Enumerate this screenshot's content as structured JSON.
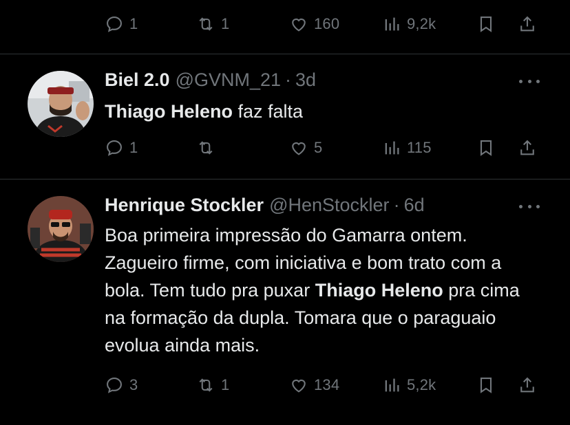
{
  "tweets": [
    {
      "stats": {
        "replies": "1",
        "retweets": "1",
        "likes": "160",
        "views": "9,2k"
      }
    },
    {
      "display_name": "Biel 2.0",
      "handle": "@GVNM_21",
      "separator": "·",
      "time": "3d",
      "text_bold_1": "Thiago Heleno",
      "text_1": " faz falta",
      "stats": {
        "replies": "1",
        "retweets": "",
        "likes": "5",
        "views": "115"
      }
    },
    {
      "display_name": "Henrique Stockler",
      "handle": "@HenStockler",
      "separator": "·",
      "time": "6d",
      "text_1": "Boa primeira impressão do Gamarra ontem. Zagueiro firme, com iniciativa e bom trato com a bola. Tem tudo pra puxar ",
      "text_bold_1": "Thiago Heleno",
      "text_2": " pra cima na formação da dupla. Tomara que o paraguaio evolua ainda mais.",
      "stats": {
        "replies": "3",
        "retweets": "1",
        "likes": "134",
        "views": "5,2k"
      }
    }
  ],
  "icons": {
    "reply": "reply-icon",
    "retweet": "retweet-icon",
    "like": "heart-icon",
    "views": "views-icon",
    "bookmark": "bookmark-icon",
    "share": "share-icon",
    "more": "more-icon"
  },
  "colors": {
    "background": "#000000",
    "text": "#e7e9ea",
    "secondary": "#71767b",
    "divider": "#2f3336"
  }
}
